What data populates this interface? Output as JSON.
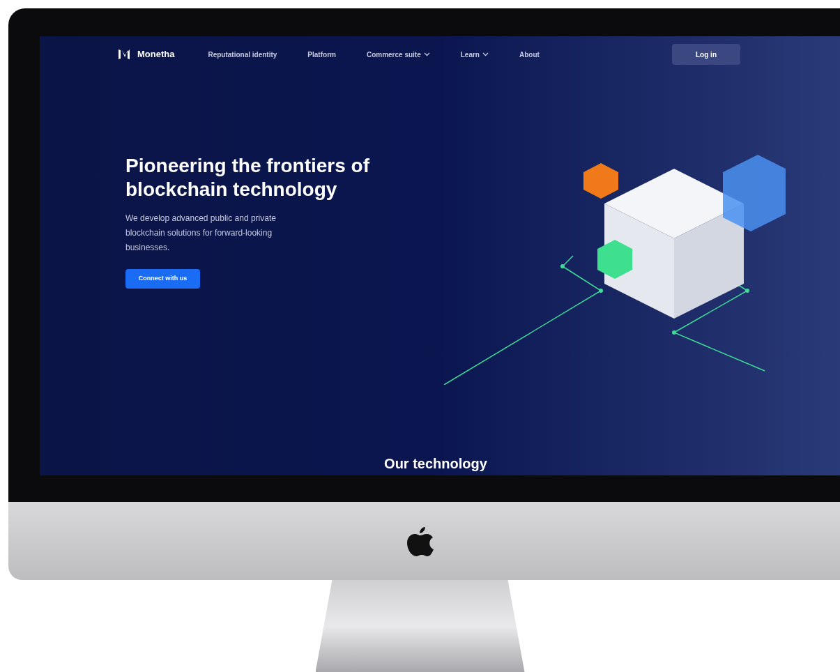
{
  "header": {
    "brand": "Monetha",
    "nav": [
      {
        "label": "Reputational identity",
        "has_menu": false
      },
      {
        "label": "Platform",
        "has_menu": false
      },
      {
        "label": "Commerce suite",
        "has_menu": true
      },
      {
        "label": "Learn",
        "has_menu": true
      },
      {
        "label": "About",
        "has_menu": false
      }
    ],
    "login": "Log in"
  },
  "hero": {
    "title": "Pioneering the frontiers of blockchain technology",
    "text": "We develop advanced public and private blockchain solutions for forward-looking businesses.",
    "button": "Connect with us"
  },
  "next_section": {
    "title": "Our technology"
  }
}
